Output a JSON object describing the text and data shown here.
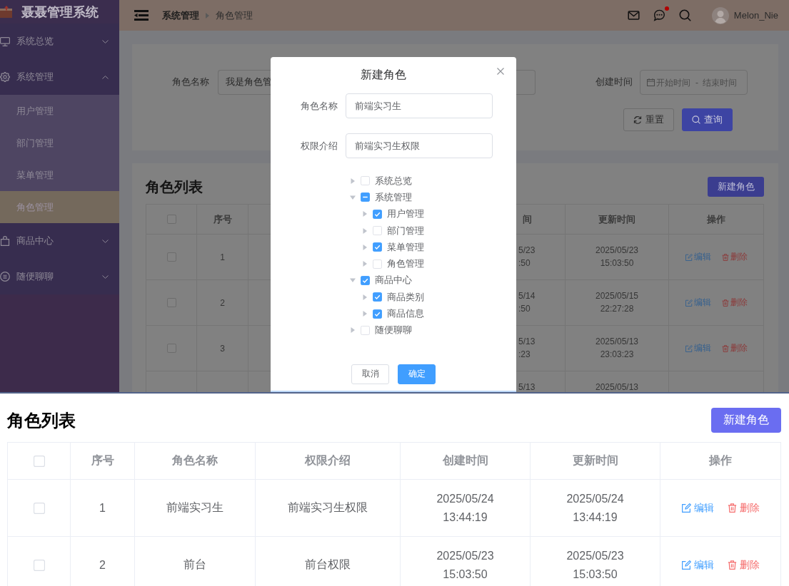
{
  "sidebar": {
    "title": "聂聂管理系统",
    "menu": [
      {
        "label": "系统总览",
        "selected": false,
        "expanded": false
      },
      {
        "label": "系统管理",
        "selected": false,
        "expanded": true,
        "children": [
          {
            "label": "用户管理",
            "selected": false
          },
          {
            "label": "部门管理",
            "selected": false
          },
          {
            "label": "菜单管理",
            "selected": false
          },
          {
            "label": "角色管理",
            "selected": true
          }
        ]
      },
      {
        "label": "商品中心",
        "selected": false,
        "expanded": false
      },
      {
        "label": "随便聊聊",
        "selected": false,
        "expanded": false
      }
    ]
  },
  "header": {
    "breadcrumb": [
      "系统管理",
      "角色管理"
    ],
    "has_unread": true,
    "user_name": "Melon_Nie"
  },
  "search": {
    "role_name": {
      "label": "角色名称",
      "value": "我是角色管"
    },
    "created_time": {
      "label": "创建时间",
      "start": {
        "placeholder": "开始时间"
      },
      "separator": "-",
      "end": {
        "placeholder": "结束时间"
      }
    },
    "buttons": [
      {
        "kind": "reset",
        "label": "重置"
      },
      {
        "kind": "search",
        "label": "查询"
      }
    ]
  },
  "table": {
    "title": "角色列表",
    "create_button": "新建角色",
    "header": {
      "checked": false,
      "index": "序号",
      "column_5": "间",
      "updated": "更新时间",
      "actions": "操作"
    },
    "rows": [
      {
        "checked": false,
        "index": "1",
        "column_5": [
          "5/23",
          ":50"
        ],
        "updated": "2025/05/23 15:03:50",
        "actions": [
          {
            "kind": "edit",
            "label": "编辑"
          },
          {
            "kind": "delete",
            "label": "删除"
          }
        ]
      },
      {
        "checked": false,
        "index": "2",
        "column_5": [
          "5/14",
          ":50"
        ],
        "updated": "2025/05/15 22:27:28",
        "actions": [
          {
            "kind": "edit",
            "label": "编辑"
          },
          {
            "kind": "delete",
            "label": "删除"
          }
        ]
      },
      {
        "checked": false,
        "index": "3",
        "column_5": [
          "5/13",
          ":23"
        ],
        "updated": "2025/05/13 23:03:23",
        "actions": [
          {
            "kind": "edit",
            "label": "编辑"
          },
          {
            "kind": "delete",
            "label": "删除"
          }
        ]
      },
      {
        "column_5": [
          "5/13"
        ],
        "updated": "2025/05/13"
      }
    ]
  },
  "dialog": {
    "title": "新建角色",
    "fields": [
      {
        "label": "角色名称",
        "value": "前端实习生"
      },
      {
        "label": "权限介绍",
        "value": "前端实习生权限"
      }
    ],
    "tree": [
      {
        "label": "系统总览",
        "checked": false,
        "indeterminate": false,
        "expanded": false
      },
      {
        "label": "系统管理",
        "checked": false,
        "indeterminate": true,
        "expanded": true,
        "children": [
          {
            "label": "用户管理",
            "checked": true,
            "indeterminate": false,
            "expanded": false
          },
          {
            "label": "部门管理",
            "checked": false,
            "indeterminate": false,
            "expanded": false
          },
          {
            "label": "菜单管理",
            "checked": true,
            "indeterminate": false,
            "expanded": false
          },
          {
            "label": "角色管理",
            "checked": false,
            "indeterminate": false,
            "expanded": false
          }
        ]
      },
      {
        "label": "商品中心",
        "checked": true,
        "indeterminate": false,
        "expanded": true,
        "children": [
          {
            "label": "商品类别",
            "checked": true,
            "indeterminate": false,
            "expanded": false
          },
          {
            "label": "商品信息",
            "checked": true,
            "indeterminate": false,
            "expanded": false
          }
        ]
      },
      {
        "label": "随便聊聊",
        "checked": false,
        "indeterminate": false,
        "expanded": false
      }
    ],
    "buttons": [
      {
        "kind": "cancel",
        "label": "取消"
      },
      {
        "kind": "confirm",
        "label": "确定"
      }
    ]
  },
  "zoomed_table": {
    "title": "角色列表",
    "create_button": "新建角色",
    "header": {
      "checked": false,
      "columns": [
        "序号",
        "角色名称",
        "权限介绍",
        "创建时间",
        "更新时间",
        "操作"
      ]
    },
    "rows": [
      {
        "checked": false,
        "cells": [
          "1",
          "前端实习生",
          "前端实习生权限",
          "2025/05/24 13:44:19",
          "2025/05/24 13:44:19"
        ],
        "actions": [
          {
            "kind": "edit",
            "label": "编辑"
          },
          {
            "kind": "delete",
            "label": "删除"
          }
        ]
      },
      {
        "checked": false,
        "cells": [
          "2",
          "前台",
          "前台权限",
          "2025/05/23 15:03:50",
          "2025/05/23 15:03:50"
        ],
        "actions": [
          {
            "kind": "edit",
            "label": "编辑"
          },
          {
            "kind": "delete",
            "label": "删除"
          }
        ]
      }
    ]
  }
}
